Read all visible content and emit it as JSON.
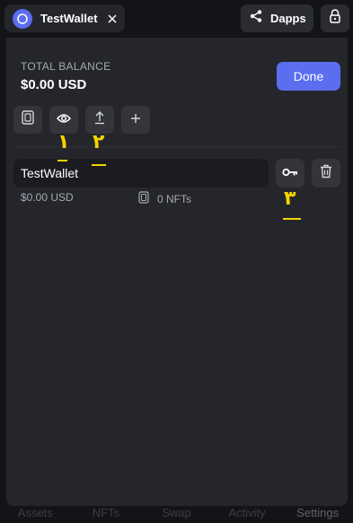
{
  "topbar": {
    "wallet_name": "TestWallet",
    "dapps_label": "Dapps"
  },
  "panel": {
    "total_label": "TOTAL BALANCE",
    "total_value": "$0.00 USD",
    "done_label": "Done",
    "wallet_name_value": "TestWallet",
    "wallet_usd": "$0.00 USD",
    "nft_count": "0 NFTs"
  },
  "annotations": {
    "one": "۱",
    "two": "۲",
    "three": "۳"
  },
  "bottom_nav": {
    "items": [
      "Assets",
      "NFTs",
      "Swap",
      "Activity",
      "Settings"
    ],
    "active": "Settings"
  },
  "colors": {
    "accent": "#5b6ef0",
    "panel": "#24262b",
    "background": "#131417",
    "annotation": "#f5d400"
  },
  "icons": {
    "wallet_avatar": "wallet-avatar-icon",
    "close": "close-icon",
    "share": "share-icon",
    "lock": "lock-icon",
    "nft": "nft-card-icon",
    "eye": "eye-icon",
    "upload": "upload-icon",
    "plus": "plus-icon",
    "key": "key-icon",
    "trash": "trash-icon"
  }
}
